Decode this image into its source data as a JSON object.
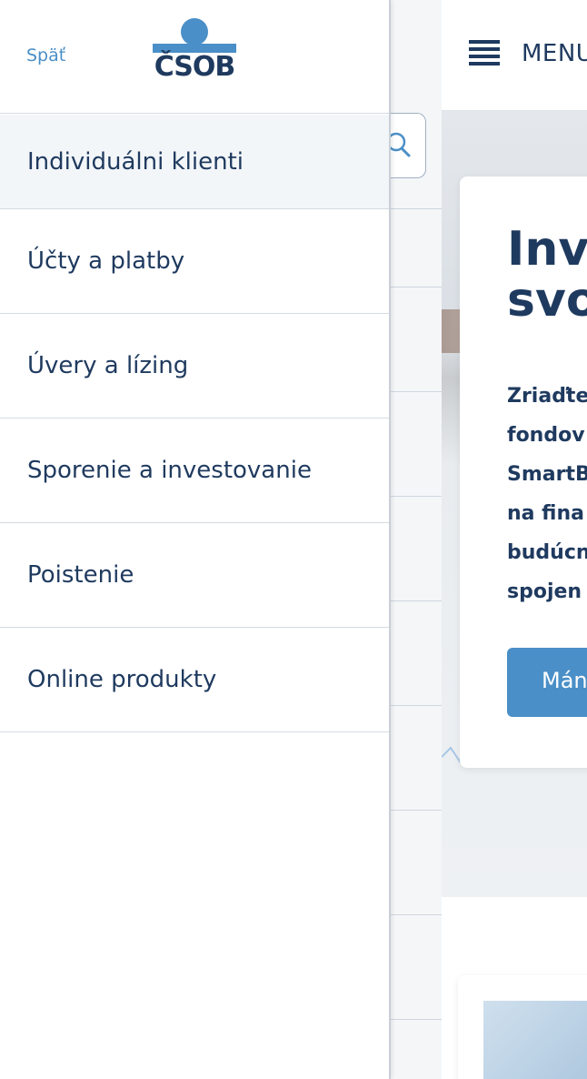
{
  "drawer": {
    "back_label": "Späť",
    "logo_text": "ČSOB",
    "items": [
      {
        "label": "Individuálni klienti",
        "active": true
      },
      {
        "label": "Účty a platby"
      },
      {
        "label": "Úvery a lízing"
      },
      {
        "label": "Sporenie a investovanie"
      },
      {
        "label": "Poistenie"
      },
      {
        "label": "Online produkty"
      }
    ]
  },
  "header": {
    "menu_label": "MENU"
  },
  "hero": {
    "title": "Inve\nsvo",
    "text": "Zriaďte\nfondov\nSmartB\nna fina\nbudúcn\nspojen",
    "button_label": "Mán"
  },
  "colors": {
    "brand_navy": "#1f3a5f",
    "accent_blue": "#4a8fc7",
    "divider": "#d5dbe2",
    "active_bg": "#f3f6f9"
  },
  "icons": {
    "menu": "hamburger-icon",
    "search": "search-icon",
    "logo": "csob-logo"
  }
}
